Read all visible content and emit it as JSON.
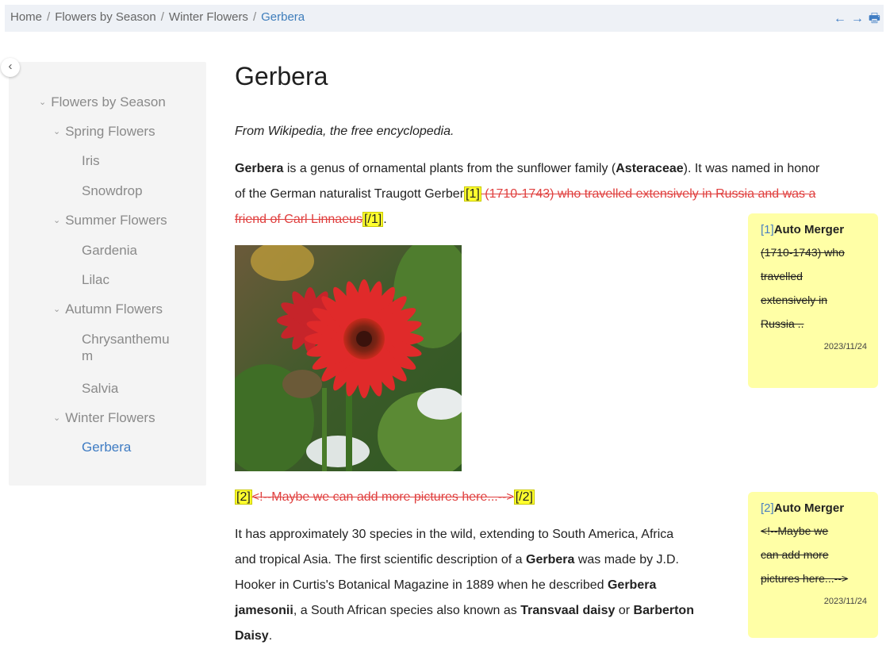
{
  "breadcrumb": {
    "items": [
      "Home",
      "Flowers by Season",
      "Winter Flowers"
    ],
    "current": "Gerbera",
    "separator": "/"
  },
  "toolbar": {
    "back_icon": "←",
    "forward_icon": "→",
    "print_icon": "🖶"
  },
  "sidebar": {
    "collapse_glyph": "‹",
    "chevron": "⌄",
    "root": "Flowers by Season",
    "groups": [
      {
        "label": "Spring Flowers",
        "items": [
          "Iris",
          "Snowdrop"
        ]
      },
      {
        "label": "Summer Flowers",
        "items": [
          "Gardenia",
          "Lilac"
        ]
      },
      {
        "label": "Autumn Flowers",
        "items": [
          "Chrysanthemu",
          "m",
          "Salvia"
        ]
      },
      {
        "label": "Winter Flowers",
        "items": [
          "Gerbera"
        ]
      }
    ]
  },
  "article": {
    "title": "Gerbera",
    "source": "From Wikipedia, the free encyclopedia.",
    "p1": {
      "bold1": "Gerbera",
      "t1": " is a genus of ornamental plants from the sunflower family (",
      "bold2": "Asteraceae",
      "t2": "). It was named in honor",
      "t3": "of the German naturalist Traugott Gerber",
      "mark_open": "[1]",
      "deleted_a": " (1710-1743) who travelled extensively in Russia and was a",
      "deleted_b": "friend of Carl Linnaeus",
      "mark_close": "[/1]",
      "end": "."
    },
    "p2": {
      "mark_open": "[2]",
      "deleted": "<!--Maybe we can add more pictures here...-->",
      "mark_close": "[/2]"
    },
    "p3": {
      "l1": "It has approximately 30 species in the wild, extending to South America, Africa",
      "l2a": "and tropical Asia. The first scientific description of a ",
      "l2b": "Gerbera",
      "l2c": " was made by J.D.",
      "l3a": "Hooker in Curtis's Botanical Magazine in 1889 when he described ",
      "l3b": "Gerbera",
      "l4a": "jamesonii",
      "l4b": ", a South African species also known as ",
      "l4c": "Transvaal daisy",
      "l4d": " or ",
      "l4e": "Barberton",
      "l5a": "Daisy",
      "l5b": "."
    }
  },
  "comments": [
    {
      "ref": "[1]",
      "author": "Auto Merger",
      "body": [
        "(1710-1743) who",
        "travelled",
        "extensively in",
        "Russia .."
      ],
      "date": "2023/11/24"
    },
    {
      "ref": "[2]",
      "author": "Auto Merger",
      "body": [
        "<!--Maybe we",
        "can add more",
        "pictures here...-->"
      ],
      "date": "2023/11/24"
    }
  ],
  "colors": {
    "accent": "#3f7cc3",
    "highlight": "#ffff2e",
    "deleted": "#e0403f",
    "comment_bg": "#ffffa6"
  }
}
